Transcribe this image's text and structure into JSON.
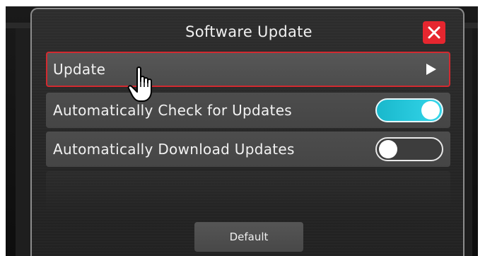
{
  "dialog": {
    "title": "Software Update",
    "close_icon": "close-icon",
    "close_color": "#e6262f",
    "accent_color": "#2cc6dc",
    "selection_color": "#d22a30"
  },
  "settings": [
    {
      "id": "update",
      "label": "Update",
      "control": "arrow",
      "icon": "chevron-right-icon",
      "selected": true
    },
    {
      "id": "auto-check",
      "label": "Automatically Check for Updates",
      "control": "toggle",
      "state": "on"
    },
    {
      "id": "auto-download",
      "label": "Automatically Download Updates",
      "control": "toggle",
      "state": "off"
    }
  ],
  "footer": {
    "default_label": "Default"
  },
  "pointer": {
    "icon": "hand-pointer-icon"
  }
}
